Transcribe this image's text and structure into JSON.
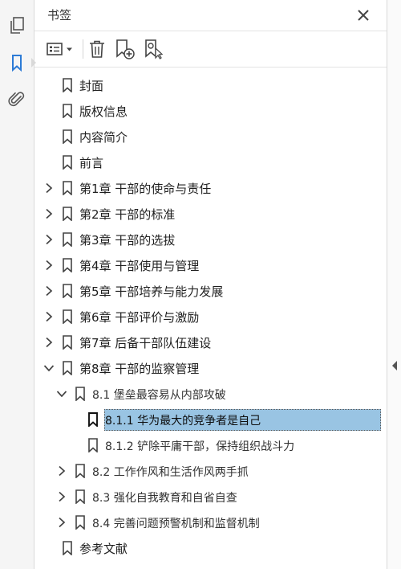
{
  "panel": {
    "title": "书签"
  },
  "toolbar": {
    "options_icon": "list-options-icon",
    "delete_icon": "trash-icon",
    "new_bookmark_icon": "new-bookmark-icon",
    "bookmark_from_selection_icon": "bookmark-search-icon"
  },
  "rail": {
    "icons": [
      "page-thumbnails-icon",
      "bookmark-icon",
      "attachment-icon"
    ],
    "active": "bookmark-icon"
  },
  "bookmarks": [
    {
      "label": "封面",
      "level": 0,
      "expandable": false
    },
    {
      "label": "版权信息",
      "level": 0,
      "expandable": false
    },
    {
      "label": "内容简介",
      "level": 0,
      "expandable": false
    },
    {
      "label": "前言",
      "level": 0,
      "expandable": false
    },
    {
      "label": "第1章 干部的使命与责任",
      "level": 0,
      "expandable": true,
      "expanded": false
    },
    {
      "label": "第2章 干部的标准",
      "level": 0,
      "expandable": true,
      "expanded": false
    },
    {
      "label": "第3章 干部的选拔",
      "level": 0,
      "expandable": true,
      "expanded": false
    },
    {
      "label": "第4章 干部使用与管理",
      "level": 0,
      "expandable": true,
      "expanded": false
    },
    {
      "label": "第5章 干部培养与能力发展",
      "level": 0,
      "expandable": true,
      "expanded": false
    },
    {
      "label": "第6章 干部评价与激励",
      "level": 0,
      "expandable": true,
      "expanded": false
    },
    {
      "label": "第7章 后备干部队伍建设",
      "level": 0,
      "expandable": true,
      "expanded": false
    },
    {
      "label": "第8章 干部的监察管理",
      "level": 0,
      "expandable": true,
      "expanded": true
    },
    {
      "label": "8.1 堡垒最容易从内部攻破",
      "level": 1,
      "expandable": true,
      "expanded": true
    },
    {
      "label": "8.1.1 华为最大的竞争者是自己",
      "level": 2,
      "expandable": false,
      "selected": true
    },
    {
      "label": "8.1.2 铲除平庸干部，保持组织战斗力",
      "level": 2,
      "expandable": false
    },
    {
      "label": "8.2 工作作风和生活作风两手抓",
      "level": 1,
      "expandable": true,
      "expanded": false
    },
    {
      "label": "8.3 强化自我教育和自省自查",
      "level": 1,
      "expandable": true,
      "expanded": false
    },
    {
      "label": "8.4 完善问题预警机制和监督机制",
      "level": 1,
      "expandable": true,
      "expanded": false
    },
    {
      "label": "参考文献",
      "level": 0,
      "expandable": false
    }
  ],
  "colors": {
    "selection": "#99c4e3",
    "accent": "#2d7bd6"
  }
}
